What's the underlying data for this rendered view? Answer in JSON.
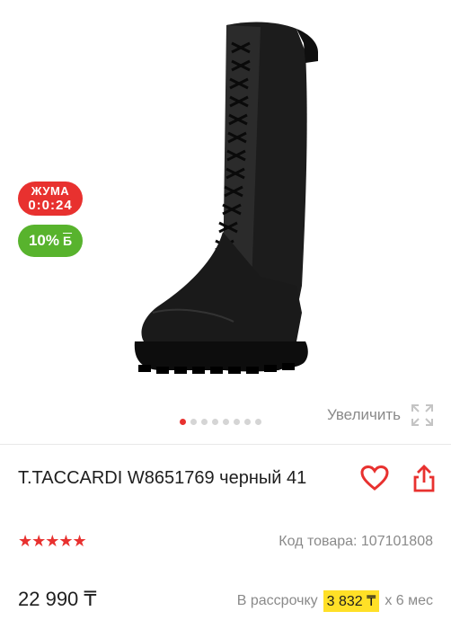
{
  "badges": {
    "friday_line1": "ЖУМА",
    "friday_line2": "0:0:24",
    "bonus_value": "10%",
    "bonus_icon": "Б"
  },
  "gallery": {
    "zoom_label": "Увеличить",
    "active_index": 0,
    "dot_count": 8
  },
  "product": {
    "title": "T.TACCARDI W8651769 черный 41",
    "stars": "★★★★★",
    "code_label": "Код товара:",
    "code_value": "107101808"
  },
  "pricing": {
    "price": "22 990 ₸",
    "installment_prefix": "В рассрочку",
    "installment_amount": "3 832 ₸",
    "installment_suffix": "х 6 мес"
  },
  "colors": {
    "accent_red": "#e8312f",
    "bonus_green": "#58b32d",
    "highlight_yellow": "#ffe027"
  }
}
